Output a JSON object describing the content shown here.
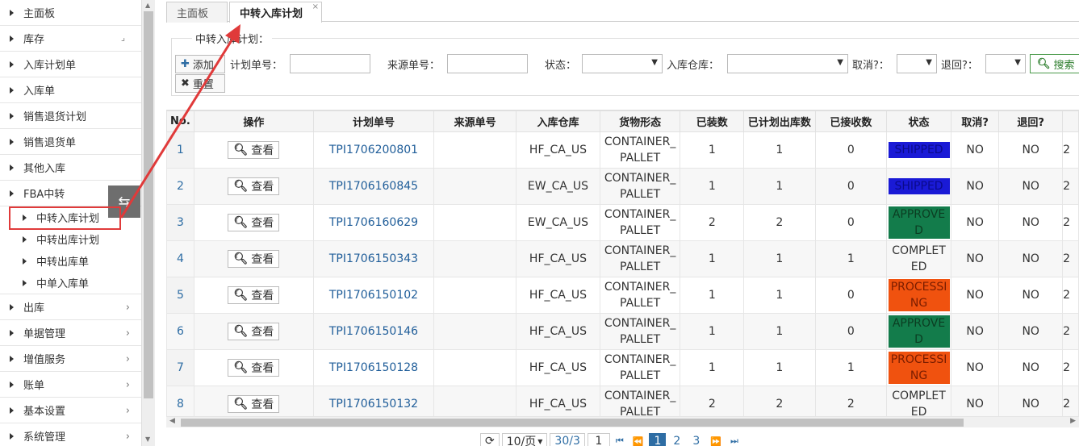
{
  "sidebar": {
    "items": [
      {
        "label": "主面板",
        "has_chevron": false
      },
      {
        "label": "库存",
        "has_chevron": false,
        "corner": "⌟"
      },
      {
        "label": "入库计划单",
        "has_chevron": false
      },
      {
        "label": "入库单",
        "has_chevron": false
      },
      {
        "label": "销售退货计划",
        "has_chevron": false
      },
      {
        "label": "销售退货单",
        "has_chevron": false
      },
      {
        "label": "其他入库",
        "has_chevron": false
      },
      {
        "label": "FBA中转",
        "has_chevron": false
      }
    ],
    "fba_sub_items": [
      "中转入库计划",
      "中转出库计划",
      "中转出库单",
      "中单入库单"
    ],
    "items_after": [
      {
        "label": "出库"
      },
      {
        "label": "单据管理"
      },
      {
        "label": "增值服务"
      },
      {
        "label": "账单"
      },
      {
        "label": "基本设置"
      },
      {
        "label": "系统管理"
      }
    ],
    "collapse_glyph": "⇆"
  },
  "tabs": [
    {
      "label": "主面板",
      "active": false
    },
    {
      "label": "中转入库计划",
      "active": true,
      "close": "×"
    }
  ],
  "filter": {
    "legend": "中转入库计划：",
    "add_label": "添加",
    "reset_label": "重置",
    "plan_no_label": "计划单号：",
    "source_no_label": "来源单号：",
    "status_label": "状态：",
    "warehouse_label": "入库仓库：",
    "cancel_label": "取消?：",
    "return_label": "退回?：",
    "search_label": "搜索"
  },
  "table": {
    "headers": [
      "No.",
      "操作",
      "计划单号",
      "来源单号",
      "入库仓库",
      "货物形态",
      "已装数",
      "已计划出库数",
      "已接收数",
      "状态",
      "取消?",
      "退回?"
    ],
    "view_label": "查看",
    "rows": [
      {
        "no": "1",
        "plan": "TPI1706200801",
        "source": "",
        "warehouse": "HF_CA_US",
        "form1": "CONTAINER_",
        "form2": "PALLET",
        "loaded": "1",
        "planned": "1",
        "received": "0",
        "status": "SHIPPED",
        "status_color": "#1a1ad6",
        "status_text": "#0a0a8a",
        "cancel": "NO",
        "ret": "NO",
        "extra": "2"
      },
      {
        "no": "2",
        "plan": "TPI1706160845",
        "source": "",
        "warehouse": "EW_CA_US",
        "form1": "CONTAINER_",
        "form2": "PALLET",
        "loaded": "1",
        "planned": "1",
        "received": "0",
        "status": "SHIPPED",
        "status_color": "#1a1ad6",
        "status_text": "#0a0a8a",
        "cancel": "NO",
        "ret": "NO",
        "extra": "2"
      },
      {
        "no": "3",
        "plan": "TPI1706160629",
        "source": "",
        "warehouse": "EW_CA_US",
        "form1": "CONTAINER_",
        "form2": "PALLET",
        "loaded": "2",
        "planned": "2",
        "received": "0",
        "status": "APPROVED",
        "status_color": "#137c4b",
        "status_text": "#0b3d22",
        "cancel": "NO",
        "ret": "NO",
        "extra": "2"
      },
      {
        "no": "4",
        "plan": "TPI1706150343",
        "source": "",
        "warehouse": "HF_CA_US",
        "form1": "CONTAINER_",
        "form2": "PALLET",
        "loaded": "1",
        "planned": "1",
        "received": "1",
        "status": "COMPLETED",
        "status_color": "",
        "status_text": "#333333",
        "cancel": "NO",
        "ret": "NO",
        "extra": "2"
      },
      {
        "no": "5",
        "plan": "TPI1706150102",
        "source": "",
        "warehouse": "HF_CA_US",
        "form1": "CONTAINER_",
        "form2": "PALLET",
        "loaded": "1",
        "planned": "1",
        "received": "0",
        "status": "PROCESSING",
        "status_color": "#f0520f",
        "status_text": "#7a1d00",
        "cancel": "NO",
        "ret": "NO",
        "extra": "2"
      },
      {
        "no": "6",
        "plan": "TPI1706150146",
        "source": "",
        "warehouse": "HF_CA_US",
        "form1": "CONTAINER_",
        "form2": "PALLET",
        "loaded": "1",
        "planned": "1",
        "received": "0",
        "status": "APPROVED",
        "status_color": "#137c4b",
        "status_text": "#0b3d22",
        "cancel": "NO",
        "ret": "NO",
        "extra": "2"
      },
      {
        "no": "7",
        "plan": "TPI1706150128",
        "source": "",
        "warehouse": "HF_CA_US",
        "form1": "CONTAINER_",
        "form2": "PALLET",
        "loaded": "1",
        "planned": "1",
        "received": "1",
        "status": "PROCESSING",
        "status_color": "#f0520f",
        "status_text": "#7a1d00",
        "cancel": "NO",
        "ret": "NO",
        "extra": "2"
      },
      {
        "no": "8",
        "plan": "TPI1706150132",
        "source": "",
        "warehouse": "HF_CA_US",
        "form1": "CONTAINER_",
        "form2": "PALLET",
        "loaded": "2",
        "planned": "2",
        "received": "2",
        "status": "COMPLETED",
        "status_color": "",
        "status_text": "#333333",
        "cancel": "NO",
        "ret": "NO",
        "extra": "2"
      }
    ]
  },
  "pager": {
    "page_size": "10/页",
    "page_info": "30/3",
    "page_input": "1",
    "pages": [
      "1",
      "2",
      "3"
    ],
    "current": "1"
  },
  "colors": {
    "annotation": "#e03a3a",
    "link": "#1f5d99",
    "accent": "#2e6da4"
  }
}
